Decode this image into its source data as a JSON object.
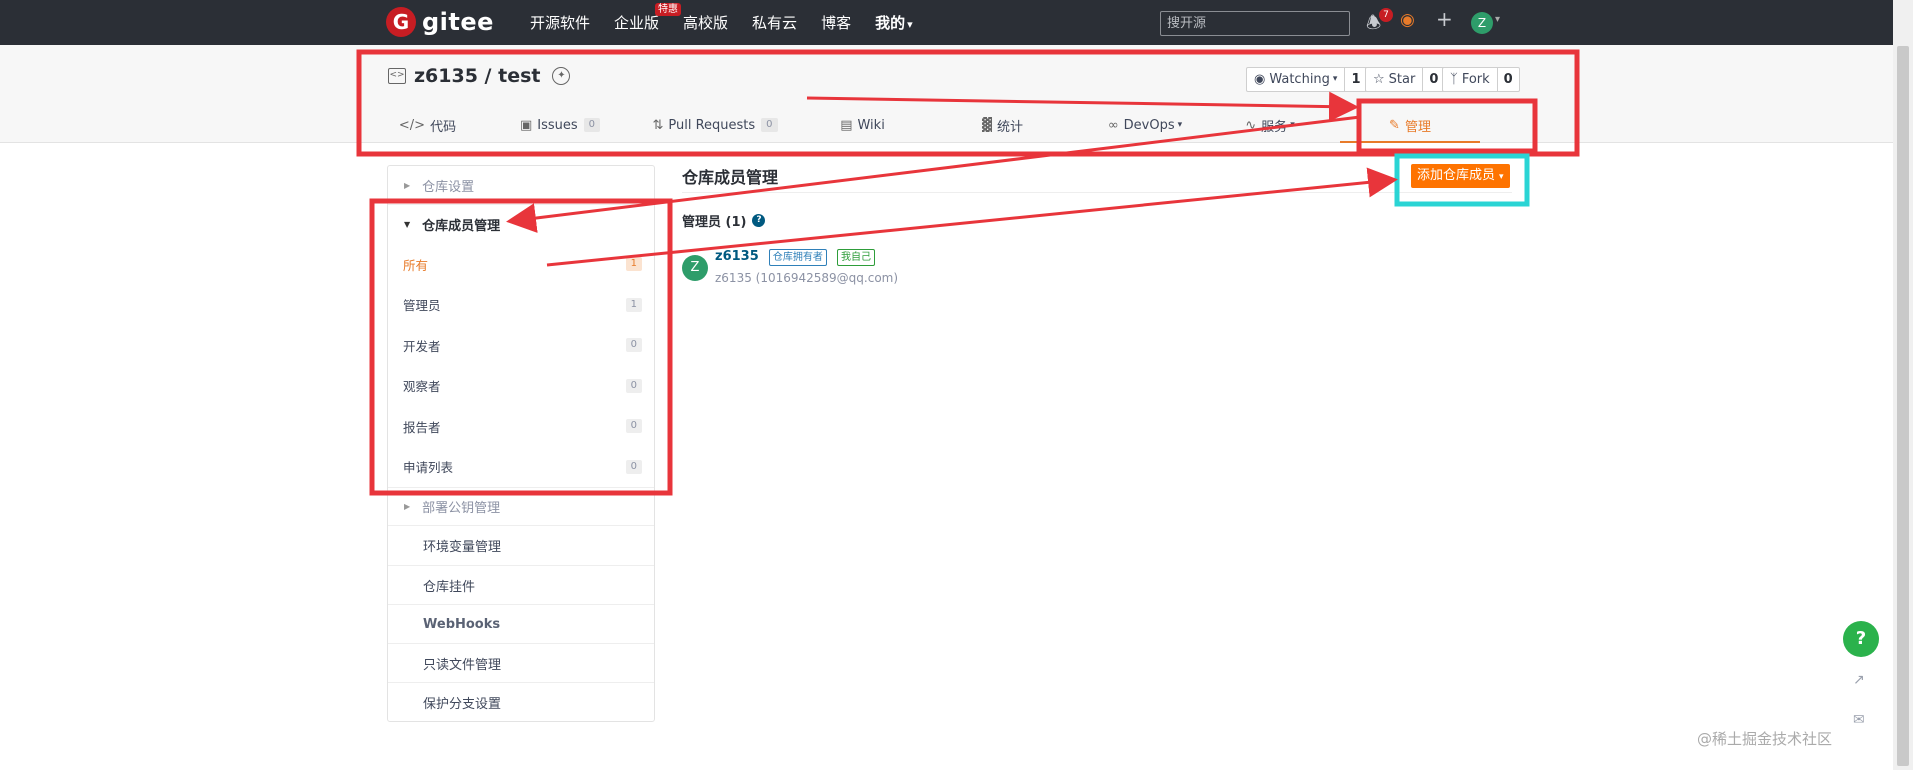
{
  "topbar": {
    "logo_letter": "G",
    "logo_text": "gitee",
    "nav": [
      {
        "label": "开源软件"
      },
      {
        "label": "企业版",
        "badge": "特惠"
      },
      {
        "label": "高校版"
      },
      {
        "label": "私有云"
      },
      {
        "label": "博客"
      },
      {
        "label": "我的",
        "caret": "▾"
      }
    ],
    "search_placeholder": "搜开源",
    "notification_count": "7",
    "avatar_letter": "Z"
  },
  "repo": {
    "name": "z6135 / test",
    "watching": {
      "label": "Watching",
      "count": "1"
    },
    "star": {
      "label": "Star",
      "count": "0"
    },
    "fork": {
      "label": "Fork",
      "count": "0"
    },
    "tabs": [
      {
        "label": "代码",
        "icon": "code-icon"
      },
      {
        "label": "Issues",
        "count": "0",
        "icon": "issues-icon"
      },
      {
        "label": "Pull Requests",
        "count": "0",
        "icon": "pull-request-icon"
      },
      {
        "label": "Wiki",
        "icon": "wiki-icon"
      },
      {
        "label": "统计",
        "icon": "stats-icon"
      },
      {
        "label": "DevOps",
        "icon": "devops-icon"
      },
      {
        "label": "服务",
        "icon": "service-icon"
      },
      {
        "label": "管理",
        "icon": "manage-icon",
        "active": true
      }
    ]
  },
  "sidebar": {
    "repo_settings": "仓库设置",
    "member_mgmt": "仓库成员管理",
    "member_subs": [
      {
        "label": "所有",
        "count": "1"
      },
      {
        "label": "管理员",
        "count": "1"
      },
      {
        "label": "开发者",
        "count": "0"
      },
      {
        "label": "观察者",
        "count": "0"
      },
      {
        "label": "报告者",
        "count": "0"
      },
      {
        "label": "申请列表",
        "count": "0"
      }
    ],
    "deploy_keys": "部署公钥管理",
    "items": [
      "环境变量管理",
      "仓库挂件",
      "WebHooks",
      "只读文件管理",
      "保护分支设置"
    ]
  },
  "main": {
    "title": "仓库成员管理",
    "add_button": "添加仓库成员",
    "section_label": "管理员 (1)",
    "member": {
      "avatar": "Z",
      "name": "z6135",
      "tag_owner": "仓库拥有者",
      "tag_self": "我自己",
      "detail": "z6135 (1016942589@qq.com)"
    }
  },
  "floating": {
    "help": "?"
  },
  "watermark": "@稀土掘金技术社区",
  "colors": {
    "accent": "#fe7300",
    "annotation_red": "#e8353b",
    "annotation_cyan": "#2ad4d4"
  }
}
